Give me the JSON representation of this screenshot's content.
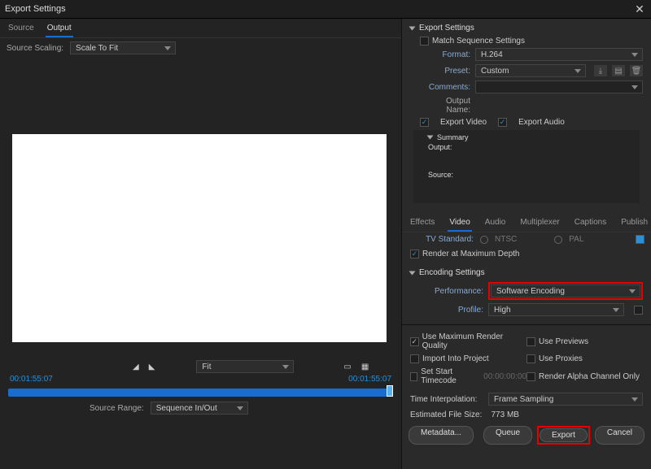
{
  "window": {
    "title": "Export Settings"
  },
  "left": {
    "tabs": [
      "Source",
      "Output"
    ],
    "active_tab": "Output",
    "source_scaling_label": "Source Scaling:",
    "source_scaling_value": "Scale To Fit",
    "tc_in": "00:01:55:07",
    "tc_out": "00:01:55:07",
    "fit_label": "Fit",
    "source_range_label": "Source Range:",
    "source_range_value": "Sequence In/Out"
  },
  "export": {
    "title": "Export Settings",
    "match_label": "Match Sequence Settings",
    "match_on": false,
    "format_label": "Format:",
    "format_value": "H.264",
    "preset_label": "Preset:",
    "preset_value": "Custom",
    "comments_label": "Comments:",
    "output_name_label": "Output Name:",
    "export_video_label": "Export Video",
    "export_video_on": true,
    "export_audio_label": "Export Audio",
    "export_audio_on": true
  },
  "summary": {
    "title": "Summary",
    "output_label": "Output:",
    "source_label": "Source:"
  },
  "tabs2": [
    "Effects",
    "Video",
    "Audio",
    "Multiplexer",
    "Captions",
    "Publish"
  ],
  "tabs2_active": "Video",
  "video": {
    "tv_standard_label": "TV Standard:",
    "tv_ntsc": "NTSC",
    "tv_pal": "PAL",
    "render_max_depth_label": "Render at Maximum Depth",
    "render_max_depth_on": true
  },
  "encoding": {
    "title": "Encoding Settings",
    "performance_label": "Performance:",
    "performance_value": "Software Encoding",
    "profile_label": "Profile:",
    "profile_value": "High"
  },
  "bottom": {
    "use_max_render_label": "Use Maximum Render Quality",
    "use_max_render_on": true,
    "use_previews_label": "Use Previews",
    "use_previews_on": false,
    "import_project_label": "Import Into Project",
    "import_project_on": false,
    "use_proxies_label": "Use Proxies",
    "use_proxies_on": false,
    "set_start_tc_label": "Set Start Timecode",
    "set_start_tc_on": false,
    "set_start_tc_val": "00:00:00:00",
    "render_alpha_label": "Render Alpha Channel Only",
    "render_alpha_on": false,
    "time_interp_label": "Time Interpolation:",
    "time_interp_value": "Frame Sampling",
    "est_size_label": "Estimated File Size:",
    "est_size_value": "773 MB"
  },
  "buttons": {
    "metadata": "Metadata...",
    "queue": "Queue",
    "export": "Export",
    "cancel": "Cancel"
  }
}
